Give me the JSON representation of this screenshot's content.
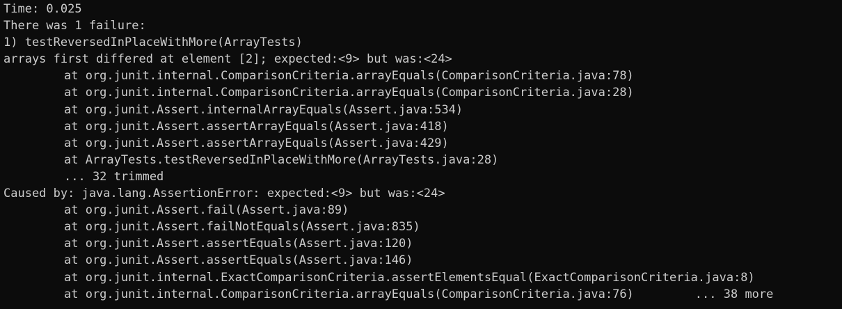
{
  "terminal": {
    "background": "#0c0c0c",
    "foreground": "#cccccc",
    "lines": {
      "time": "Time: 0.025",
      "failure_count": "There was 1 failure:",
      "failure_header": "1) testReversedInPlaceWithMore(ArrayTests)",
      "failure_message": "arrays first differed at element [2]; expected:<9> but was:<24>",
      "trace1": [
        "at org.junit.internal.ComparisonCriteria.arrayEquals(ComparisonCriteria.java:78)",
        "at org.junit.internal.ComparisonCriteria.arrayEquals(ComparisonCriteria.java:28)",
        "at org.junit.Assert.internalArrayEquals(Assert.java:534)",
        "at org.junit.Assert.assertArrayEquals(Assert.java:418)",
        "at org.junit.Assert.assertArrayEquals(Assert.java:429)",
        "at ArrayTests.testReversedInPlaceWithMore(ArrayTests.java:28)",
        "... 32 trimmed"
      ],
      "caused_by": "Caused by: java.lang.AssertionError: expected:<9> but was:<24>",
      "trace2": [
        "at org.junit.Assert.fail(Assert.java:89)",
        "at org.junit.Assert.failNotEquals(Assert.java:835)",
        "at org.junit.Assert.assertEquals(Assert.java:120)",
        "at org.junit.Assert.assertEquals(Assert.java:146)",
        "at org.junit.internal.ExactComparisonCriteria.assertElementsEqual(ExactComparisonCriteria.java:8)",
        "at org.junit.internal.ComparisonCriteria.arrayEquals(ComparisonCriteria.java:76)"
      ],
      "more_note": "... 38 more"
    }
  }
}
